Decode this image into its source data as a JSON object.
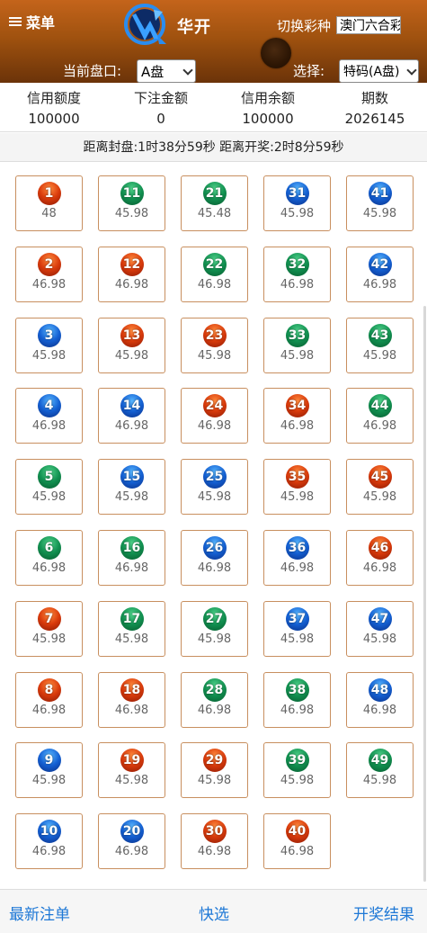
{
  "header": {
    "menu_label": "菜单",
    "brand": "华开",
    "switch_label": "切换彩种",
    "lottery_value": "澳门六合彩",
    "disk_label": "当前盘口:",
    "disk_value": "A盘",
    "choose_label": "选择:",
    "type_value": "特码(A盘)"
  },
  "info": [
    {
      "label": "信用额度",
      "value": "100000"
    },
    {
      "label": "下注金额",
      "value": "0"
    },
    {
      "label": "信用余额",
      "value": "100000"
    },
    {
      "label": "期数",
      "value": "2026145"
    }
  ],
  "countdown": "距离封盘:1时38分59秒  距离开奖:2时8分59秒",
  "balls": [
    {
      "num": "1",
      "odds": "48",
      "color": "red"
    },
    {
      "num": "11",
      "odds": "45.98",
      "color": "green"
    },
    {
      "num": "21",
      "odds": "45.48",
      "color": "green"
    },
    {
      "num": "31",
      "odds": "45.98",
      "color": "blue"
    },
    {
      "num": "41",
      "odds": "45.98",
      "color": "blue"
    },
    {
      "num": "2",
      "odds": "46.98",
      "color": "red"
    },
    {
      "num": "12",
      "odds": "46.98",
      "color": "red"
    },
    {
      "num": "22",
      "odds": "46.98",
      "color": "green"
    },
    {
      "num": "32",
      "odds": "46.98",
      "color": "green"
    },
    {
      "num": "42",
      "odds": "46.98",
      "color": "blue"
    },
    {
      "num": "3",
      "odds": "45.98",
      "color": "blue"
    },
    {
      "num": "13",
      "odds": "45.98",
      "color": "red"
    },
    {
      "num": "23",
      "odds": "45.98",
      "color": "red"
    },
    {
      "num": "33",
      "odds": "45.98",
      "color": "green"
    },
    {
      "num": "43",
      "odds": "45.98",
      "color": "green"
    },
    {
      "num": "4",
      "odds": "46.98",
      "color": "blue"
    },
    {
      "num": "14",
      "odds": "46.98",
      "color": "blue"
    },
    {
      "num": "24",
      "odds": "46.98",
      "color": "red"
    },
    {
      "num": "34",
      "odds": "46.98",
      "color": "red"
    },
    {
      "num": "44",
      "odds": "46.98",
      "color": "green"
    },
    {
      "num": "5",
      "odds": "45.98",
      "color": "green"
    },
    {
      "num": "15",
      "odds": "45.98",
      "color": "blue"
    },
    {
      "num": "25",
      "odds": "45.98",
      "color": "blue"
    },
    {
      "num": "35",
      "odds": "45.98",
      "color": "red"
    },
    {
      "num": "45",
      "odds": "45.98",
      "color": "red"
    },
    {
      "num": "6",
      "odds": "46.98",
      "color": "green"
    },
    {
      "num": "16",
      "odds": "46.98",
      "color": "green"
    },
    {
      "num": "26",
      "odds": "46.98",
      "color": "blue"
    },
    {
      "num": "36",
      "odds": "46.98",
      "color": "blue"
    },
    {
      "num": "46",
      "odds": "46.98",
      "color": "red"
    },
    {
      "num": "7",
      "odds": "45.98",
      "color": "red"
    },
    {
      "num": "17",
      "odds": "45.98",
      "color": "green"
    },
    {
      "num": "27",
      "odds": "45.98",
      "color": "green"
    },
    {
      "num": "37",
      "odds": "45.98",
      "color": "blue"
    },
    {
      "num": "47",
      "odds": "45.98",
      "color": "blue"
    },
    {
      "num": "8",
      "odds": "46.98",
      "color": "red"
    },
    {
      "num": "18",
      "odds": "46.98",
      "color": "red"
    },
    {
      "num": "28",
      "odds": "46.98",
      "color": "green"
    },
    {
      "num": "38",
      "odds": "46.98",
      "color": "green"
    },
    {
      "num": "48",
      "odds": "46.98",
      "color": "blue"
    },
    {
      "num": "9",
      "odds": "45.98",
      "color": "blue"
    },
    {
      "num": "19",
      "odds": "45.98",
      "color": "red"
    },
    {
      "num": "29",
      "odds": "45.98",
      "color": "red"
    },
    {
      "num": "39",
      "odds": "45.98",
      "color": "green"
    },
    {
      "num": "49",
      "odds": "45.98",
      "color": "green"
    },
    {
      "num": "10",
      "odds": "46.98",
      "color": "blue"
    },
    {
      "num": "20",
      "odds": "46.98",
      "color": "blue"
    },
    {
      "num": "30",
      "odds": "46.98",
      "color": "red"
    },
    {
      "num": "40",
      "odds": "46.98",
      "color": "red"
    }
  ],
  "footer": {
    "latest_bets": "最新注单",
    "quick_select": "快选",
    "draw_results": "开奖结果"
  },
  "colors": {
    "header_top": "#c4641b",
    "header_bottom": "#6b3309",
    "cell_border": "#c88f5f",
    "link_blue": "#1e78d6"
  }
}
